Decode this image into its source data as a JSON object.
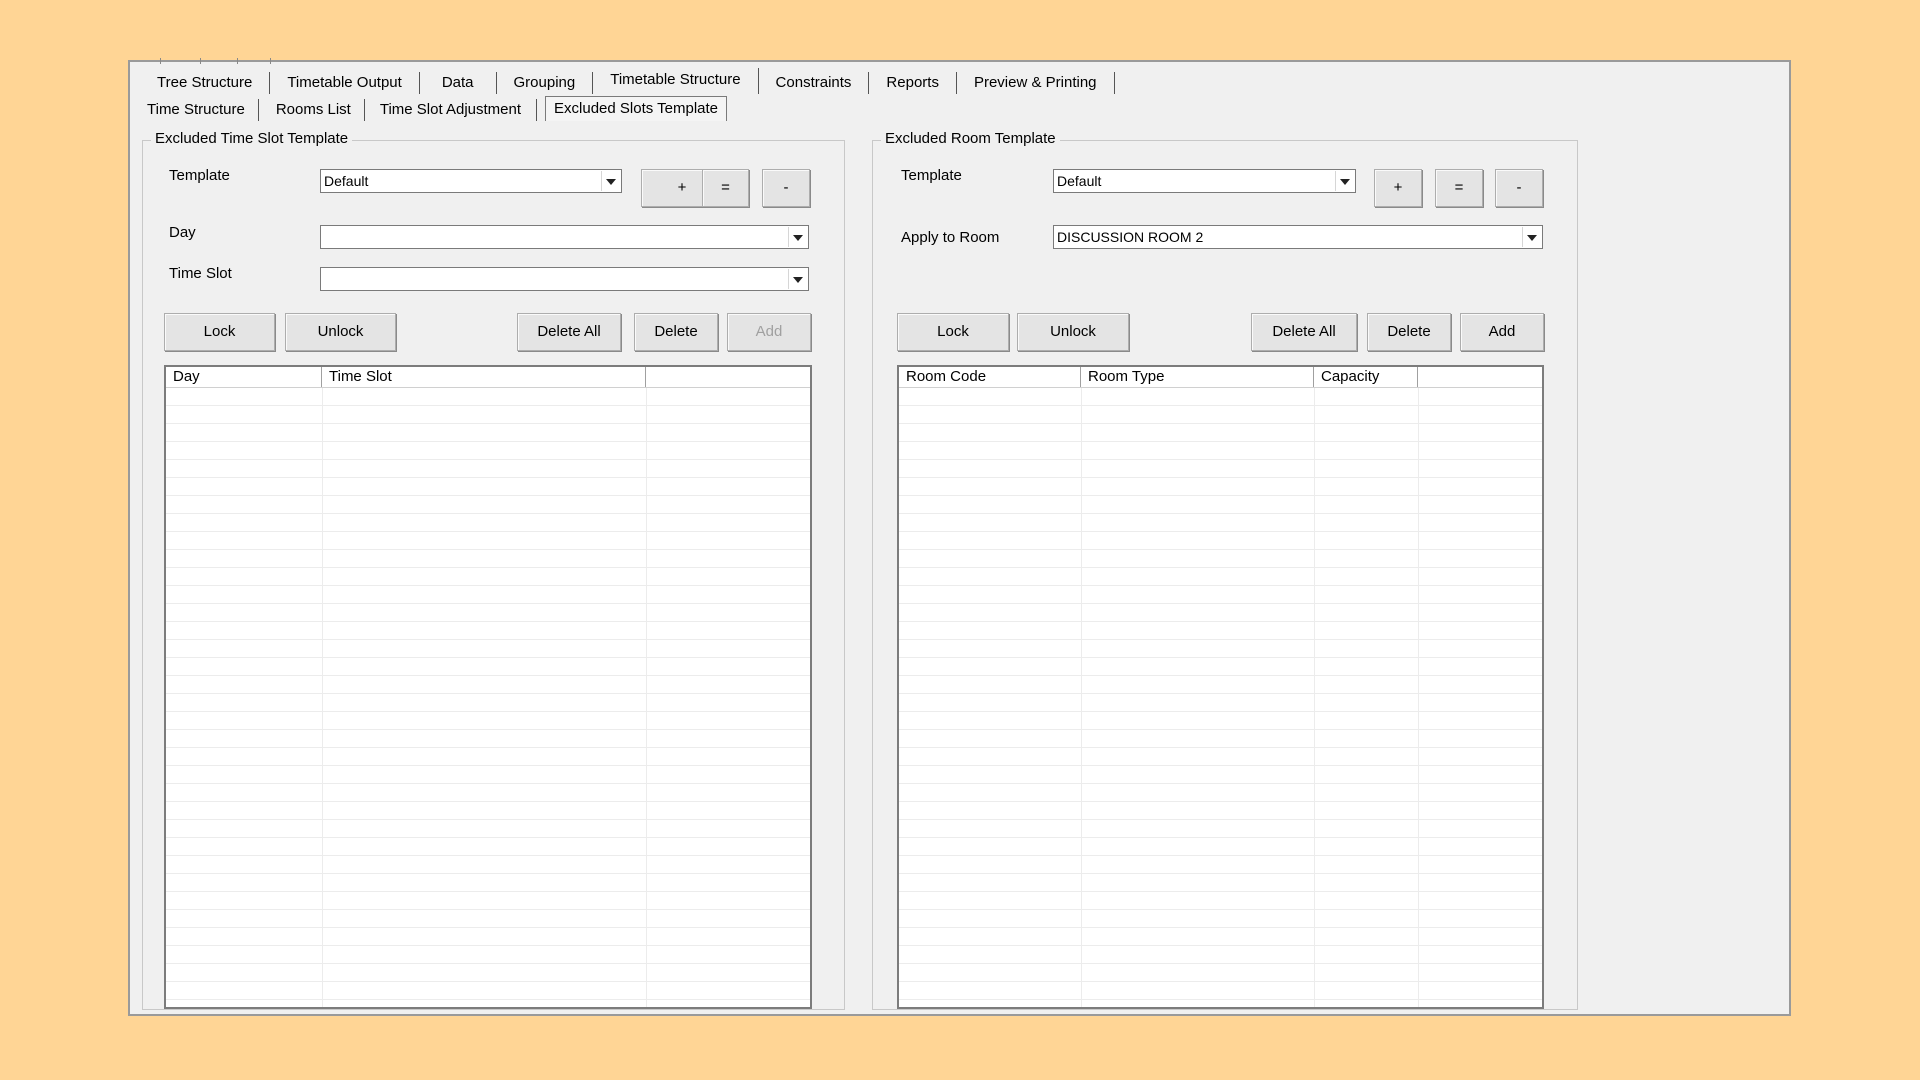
{
  "main_tabs": [
    {
      "label": "Tree Structure"
    },
    {
      "label": "Timetable Output"
    },
    {
      "label": "Data"
    },
    {
      "label": "Grouping"
    },
    {
      "label": "Timetable Structure"
    },
    {
      "label": "Constraints"
    },
    {
      "label": "Reports"
    },
    {
      "label": "Preview & Printing"
    }
  ],
  "active_main_tab": "Timetable Structure",
  "sub_tabs": [
    {
      "label": "Time Structure"
    },
    {
      "label": "Rooms List"
    },
    {
      "label": "Time Slot Adjustment"
    },
    {
      "label": "Excluded Slots Template"
    }
  ],
  "active_sub_tab": "Excluded Slots Template",
  "time_slot_panel": {
    "title": "Excluded Time Slot Template",
    "template_label": "Template",
    "template_value": "Default",
    "day_label": "Day",
    "day_value": "",
    "time_slot_label": "Time Slot",
    "time_slot_value": "",
    "plus": "+",
    "equals": "=",
    "minus": "-",
    "lock": "Lock",
    "unlock": "Unlock",
    "delete_all": "Delete All",
    "delete": "Delete",
    "add": "Add",
    "columns": [
      "Day",
      "Time Slot",
      ""
    ]
  },
  "room_panel": {
    "title": "Excluded Room Template",
    "template_label": "Template",
    "template_value": "Default",
    "apply_label": "Apply to Room",
    "apply_value": "DISCUSSION ROOM 2",
    "plus": "+",
    "equals": "=",
    "minus": "-",
    "lock": "Lock",
    "unlock": "Unlock",
    "delete_all": "Delete All",
    "delete": "Delete",
    "add": "Add",
    "columns": [
      "Room Code",
      "Room Type",
      "Capacity",
      ""
    ]
  },
  "colors": {
    "background": "#FFD595",
    "window": "#F0F0F0",
    "disabled_text": "#A0A0A0"
  }
}
